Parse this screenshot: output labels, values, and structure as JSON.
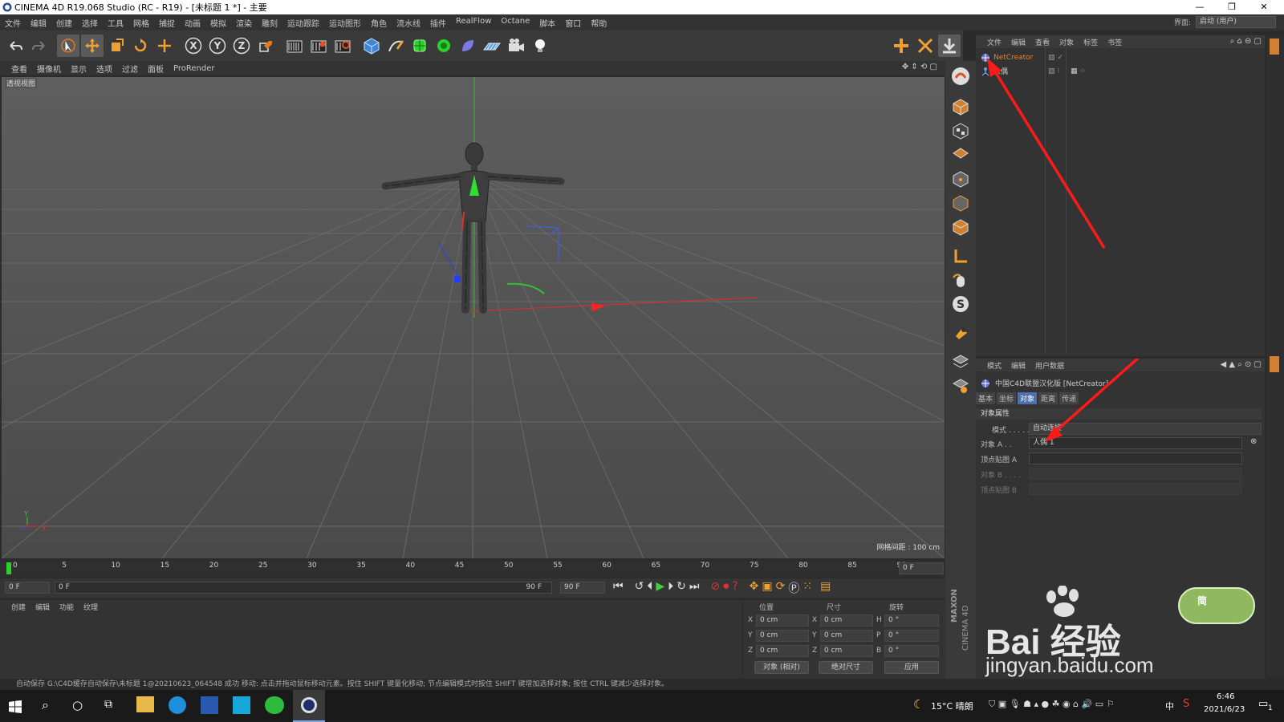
{
  "window": {
    "title": "CINEMA 4D R19.068 Studio (RC - R19) - [未标题 1 *] - 主要",
    "minimize": "—",
    "maximize": "❐",
    "close": "✕"
  },
  "menubar": {
    "items": [
      "文件",
      "编辑",
      "创建",
      "选择",
      "工具",
      "网格",
      "捕捉",
      "动画",
      "模拟",
      "渲染",
      "雕刻",
      "运动跟踪",
      "运动图形",
      "角色",
      "流水线",
      "插件",
      "RealFlow",
      "Octane",
      "脚本",
      "窗口",
      "帮助"
    ],
    "layout_label": "界面:",
    "layout_value": "启动 (用户)"
  },
  "viewport": {
    "menu": [
      "查看",
      "摄像机",
      "显示",
      "选项",
      "过滤",
      "面板",
      "ProRender"
    ],
    "label": "透视视图",
    "grid_info": "网格间距 : 100 cm",
    "axis_y": "Y",
    "axis_x": "X",
    "axis_z": "Z"
  },
  "objects": {
    "menu": [
      "文件",
      "编辑",
      "查看",
      "对象",
      "标签",
      "书签"
    ],
    "item1": "NetCreator",
    "item2": "人偶"
  },
  "attributes": {
    "menu": [
      "模式",
      "编辑",
      "用户数据"
    ],
    "object_title": "中国C4D联盟汉化版 [NetCreator]",
    "tabs": [
      "基本",
      "坐标",
      "对象",
      "距离",
      "传递"
    ],
    "section": "对象属性",
    "mode_label": "模式 . . . . .",
    "mode_value": "自动连接",
    "objA_label": "对象 A . .",
    "objA_value": "人偶 1",
    "vmapA_label": "顶点贴图 A",
    "objB_label": "对象 B . . . .",
    "vmapB_label": "顶点贴图 B"
  },
  "timeline": {
    "ticks": [
      "0",
      "5",
      "10",
      "15",
      "20",
      "25",
      "30",
      "35",
      "40",
      "45",
      "50",
      "55",
      "60",
      "65",
      "70",
      "75",
      "80",
      "85",
      "90"
    ],
    "end_frame": "0 F",
    "start_field": "0 F",
    "range_start": "0 F",
    "range_end": "90 F",
    "max_field": "90 F"
  },
  "materials": {
    "menu": [
      "创建",
      "编辑",
      "功能",
      "纹理"
    ]
  },
  "coords": {
    "headers": [
      "位置",
      "尺寸",
      "旋转"
    ],
    "pos": [
      "X",
      "Y",
      "Z"
    ],
    "rot": [
      "H",
      "P",
      "B"
    ],
    "val_cm": "0 cm",
    "val_deg": "0 °",
    "mode1": "对象 (相对)",
    "mode2": "绝对尺寸",
    "apply": "应用"
  },
  "status": {
    "text": "自动保存 G:\\C4D缓存自动保存\\未标题 1@20210623_064548 成功    移动: 点击并拖动鼠标移动元素。按住 SHIFT 键量化移动; 节点编辑模式时按住 SHIFT 键增加选择对象; 按住 CTRL 键减少选择对象。"
  },
  "brand": {
    "maxon": "MAXON",
    "c4d": "CINEMA 4D"
  },
  "watermark": {
    "main": "Bai 经验",
    "sub": "jingyan.baidu.com",
    "badge": "简"
  },
  "taskbar": {
    "weather": "15°C 晴朗",
    "lang": "中",
    "time": "6:46",
    "date": "2021/6/23",
    "notif": "1"
  },
  "colors": {
    "accent": "#4d6fae",
    "x_axis": "#e03030",
    "y_axis": "#30d030",
    "z_axis": "#3050e0",
    "arrow": "#ff1a1a"
  }
}
